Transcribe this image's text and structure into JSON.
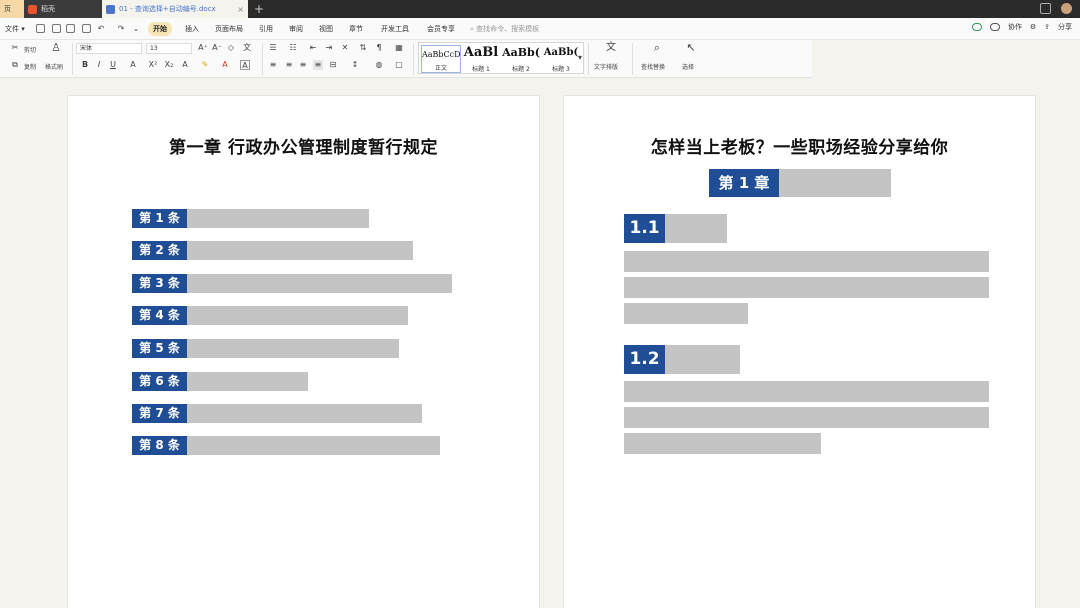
{
  "tabs": [
    {
      "label": "页",
      "icon": "page-icon"
    },
    {
      "label": "稻壳",
      "icon": "docer-icon"
    },
    {
      "label": "01 - 查询选择+自动编号.docx",
      "icon": "word-doc-icon",
      "close": "×"
    }
  ],
  "new_tab_label": "+",
  "menu": {
    "file": "文件",
    "tabs": [
      "开始",
      "插入",
      "页面布局",
      "引用",
      "审阅",
      "视图",
      "章节",
      "开发工具",
      "会员专享"
    ],
    "active_tab": "开始",
    "search_placeholder": "查找命令、搜索模板",
    "collab": "协作",
    "share": "分享"
  },
  "ribbon": {
    "cut": "剪切",
    "copy": "复制",
    "format_painter": "格式刷",
    "font_name": "宋体",
    "font_size": "13",
    "styles": [
      {
        "sample": "AaBbCcDd",
        "name": "正文",
        "selected": true
      },
      {
        "sample": "AaBl",
        "name": "标题 1",
        "selected": false
      },
      {
        "sample": "AaBb(",
        "name": "标题 2",
        "selected": false
      },
      {
        "sample": "AaBb(",
        "name": "标题 3",
        "selected": false
      }
    ],
    "text_layout": "文字排版",
    "find_replace": "查找替换",
    "select": "选择"
  },
  "colors": {
    "accent": "#1f4e96",
    "placeholder_bar": "#c4c4c4",
    "active_tab_bg": "#f7e4b5"
  },
  "left_page": {
    "title": "第一章 行政办公管理制度暂行规定",
    "articles": [
      {
        "label": "第 1 条",
        "fill": 0.62
      },
      {
        "label": "第 2 条",
        "fill": 0.77
      },
      {
        "label": "第 3 条",
        "fill": 0.9
      },
      {
        "label": "第 4 条",
        "fill": 0.75
      },
      {
        "label": "第 5 条",
        "fill": 0.72
      },
      {
        "label": "第 6 条",
        "fill": 0.41
      },
      {
        "label": "第 7 条",
        "fill": 0.8
      },
      {
        "label": "第 8 条",
        "fill": 0.86
      }
    ]
  },
  "right_page": {
    "title": "怎样当上老板？一些职场经验分享给你",
    "chapter_label": "第 1 章",
    "sections": [
      {
        "label": "1.1",
        "bar_fill": 0.19,
        "paragraph_fills": [
          1.0,
          1.0,
          0.34
        ]
      },
      {
        "label": "1.2",
        "bar_fill": 0.23,
        "paragraph_fills": [
          1.0,
          1.0,
          0.54
        ]
      }
    ]
  }
}
